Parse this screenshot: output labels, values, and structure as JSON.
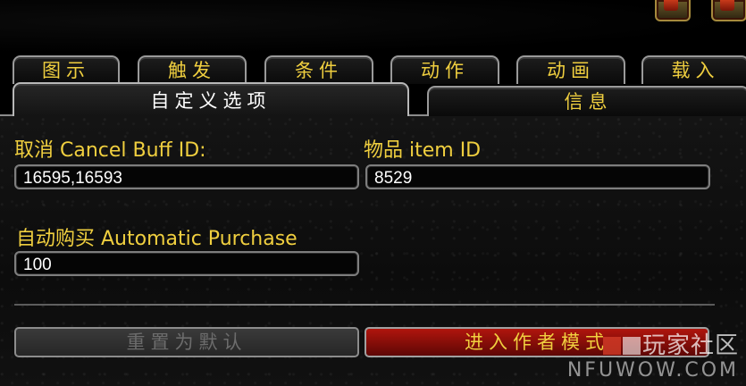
{
  "tabs_row1": [
    {
      "label": "图示"
    },
    {
      "label": "触发"
    },
    {
      "label": "条件"
    },
    {
      "label": "动作"
    },
    {
      "label": "动画"
    },
    {
      "label": "载入"
    }
  ],
  "tabs_row2": [
    {
      "label": "自定义选项",
      "active": true
    },
    {
      "label": "信息",
      "active": false
    }
  ],
  "fields": {
    "cancel_buff": {
      "label": "取消 Cancel Buff ID:",
      "value": "16595,16593"
    },
    "item": {
      "label": "物品 item ID",
      "value": "8529"
    },
    "auto_purchase": {
      "label": "自动购买 Automatic Purchase",
      "value": "100"
    }
  },
  "buttons": {
    "reset_default": "重置为默认",
    "enter_author_mode": "进入作者模式"
  },
  "watermark": {
    "brand": "玩家社区",
    "url": "NFUWOW.COM"
  },
  "colors": {
    "label_gold": "#f0cf3f",
    "primary_button_red": "#b0150d",
    "disabled_button_gray": "#3a3a3a"
  }
}
